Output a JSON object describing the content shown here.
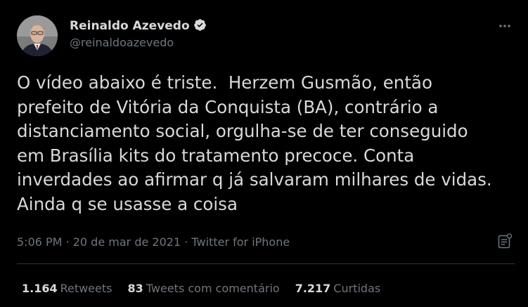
{
  "author": {
    "name": "Reinaldo Azevedo",
    "handle": "@reinaldoazevedo",
    "verified_icon": "verified-badge-icon"
  },
  "tweet": {
    "text": "O vídeo abaixo é triste.  Herzem Gusmão, então\nprefeito de Vitória da Conquista (BA), contrário a\ndistanciamento social, orgulha-se de ter conseguido\nem Brasília kits do tratamento precoce. Conta\ninverdades ao afirmar q já salvaram milhares de vidas.\nAinda q se usasse a coisa"
  },
  "meta": {
    "time": "5:06 PM",
    "separator1": " · ",
    "date": "20 de mar de 2021",
    "separator2": " · ",
    "source": "Twitter for iPhone"
  },
  "stats": {
    "retweets_count": "1.164",
    "retweets_label": "Retweets",
    "quotes_count": "83",
    "quotes_label": "Tweets com comentário",
    "likes_count": "7.217",
    "likes_label": "Curtidas"
  },
  "colors": {
    "background": "#000000",
    "text": "#d9d9d9",
    "secondary": "#6e767d",
    "divider": "#2f3336"
  }
}
